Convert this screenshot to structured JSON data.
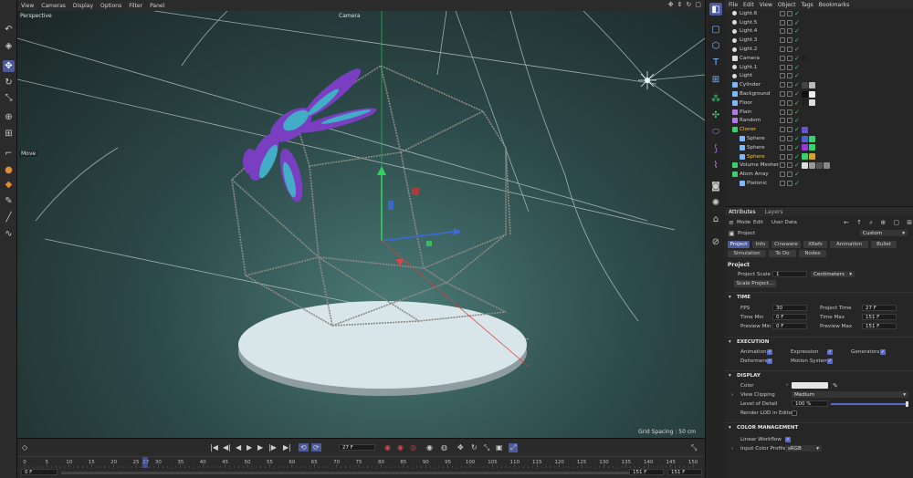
{
  "viewport": {
    "menu": [
      "View",
      "Cameras",
      "Display",
      "Options",
      "Filter",
      "Panel"
    ],
    "title": "Perspective",
    "camera": "Camera",
    "grid_spacing": "Grid Spacing : 50 cm",
    "tool_label": "Move"
  },
  "object_manager": {
    "menu": [
      "File",
      "Edit",
      "View",
      "Object",
      "Tags",
      "Bookmarks"
    ],
    "objects": [
      {
        "name": "Light.6",
        "icon": "light-icon"
      },
      {
        "name": "Light.5",
        "icon": "light-icon"
      },
      {
        "name": "Light.4",
        "icon": "light-icon"
      },
      {
        "name": "Light.3",
        "icon": "light-icon"
      },
      {
        "name": "Light.2",
        "icon": "light-icon"
      },
      {
        "name": "Camera",
        "icon": "camera-icon"
      },
      {
        "name": "Light.1",
        "icon": "light-icon"
      },
      {
        "name": "Light",
        "icon": "light-icon"
      },
      {
        "name": "Cylinder",
        "icon": "cylinder-icon"
      },
      {
        "name": "Background",
        "icon": "background-icon"
      },
      {
        "name": "Floor",
        "icon": "floor-icon"
      },
      {
        "name": "Plain",
        "icon": "plain-effector-icon"
      },
      {
        "name": "Random",
        "icon": "random-effector-icon"
      },
      {
        "name": "Cloner",
        "icon": "cloner-icon"
      },
      {
        "name": "Sphere",
        "icon": "sphere-icon"
      },
      {
        "name": "Sphere",
        "icon": "sphere-icon"
      },
      {
        "name": "Sphere",
        "icon": "sphere-icon"
      },
      {
        "name": "Volume Mesher",
        "icon": "volume-mesher-icon"
      },
      {
        "name": "Atom Array",
        "icon": "atom-array-icon"
      },
      {
        "name": "Platonic",
        "icon": "platonic-icon"
      }
    ]
  },
  "attributes": {
    "tabs": [
      "Attributes",
      "Layers"
    ],
    "menu": [
      "Mode",
      "Edit",
      "User Data"
    ],
    "object": "Project",
    "preset": "Custom",
    "subtabs": [
      "Project",
      "Info",
      "Cineware",
      "XRefs",
      "Animation",
      "Bullet",
      "Simulation",
      "To Do",
      "Nodes"
    ],
    "section_title": "Project",
    "project_scale_label": "Project Scale",
    "project_scale_value": "1",
    "project_scale_unit": "Centimeters",
    "scale_project_button": "Scale Project...",
    "time": {
      "header": "TIME",
      "fps_label": "FPS",
      "fps": "30",
      "project_time_label": "Project Time",
      "project_time": "27 F",
      "time_min_label": "Time Min",
      "time_min": "0 F",
      "time_max_label": "Time Max",
      "time_max": "151 F",
      "preview_min_label": "Preview Min",
      "preview_min": "0 F",
      "preview_max_label": "Preview Max",
      "preview_max": "151 F"
    },
    "execution": {
      "header": "EXECUTION",
      "animation": "Animation",
      "expression": "Expression",
      "generators": "Generators",
      "deformers": "Deformers",
      "motion_system": "Motion System"
    },
    "display": {
      "header": "DISPLAY",
      "color_label": "Color",
      "view_clipping_label": "View Clipping",
      "view_clipping": "Medium",
      "lod_label": "Level of Detail",
      "lod": "100 %",
      "render_lod_label": "Render LOD in Editor"
    },
    "color_management": {
      "header": "COLOR MANAGEMENT",
      "linear_workflow_label": "Linear Workflow",
      "input_color_profile_label": "Input Color Profile",
      "input_color_profile": "sRGB"
    }
  },
  "timeline": {
    "current_frame": "27 F",
    "start_field": "0 F",
    "end_field": "151 F",
    "end_field2": "151 F",
    "playhead": 27,
    "ticks": [
      "0",
      "5",
      "10",
      "15",
      "20",
      "25",
      "27",
      "30",
      "35",
      "40",
      "45",
      "50",
      "55",
      "60",
      "65",
      "70",
      "75",
      "80",
      "85",
      "90",
      "95",
      "100",
      "105",
      "110",
      "115",
      "120",
      "125",
      "130",
      "135",
      "140",
      "145",
      "150"
    ]
  },
  "colors": {
    "accent": "#4d5a9c",
    "selected_text": "#f3c34a",
    "enabled_check": "#3ad06a"
  }
}
